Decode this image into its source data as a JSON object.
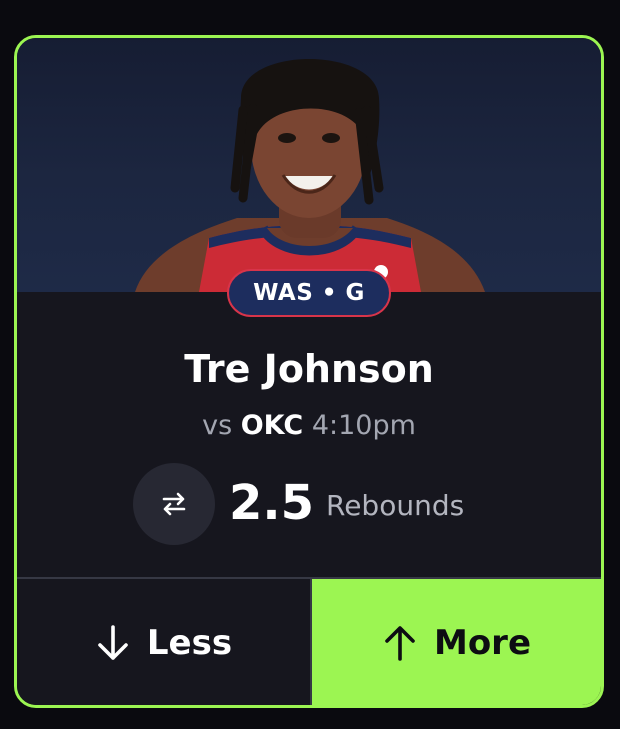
{
  "card": {
    "accent_color": "#9cf552",
    "background_color": "#16161e"
  },
  "player": {
    "team_position": "WAS • G",
    "name": "Tre Johnson",
    "matchup_prefix": "vs",
    "opponent": "OKC",
    "game_time": "4:10pm",
    "photo_icon": "player-headshot"
  },
  "projection": {
    "swap_icon": "swap-arrows-icon",
    "line": "2.5",
    "stat": "Rebounds"
  },
  "actions": {
    "less_label": "Less",
    "less_icon": "arrow-down-icon",
    "more_label": "More",
    "more_icon": "arrow-up-icon"
  }
}
